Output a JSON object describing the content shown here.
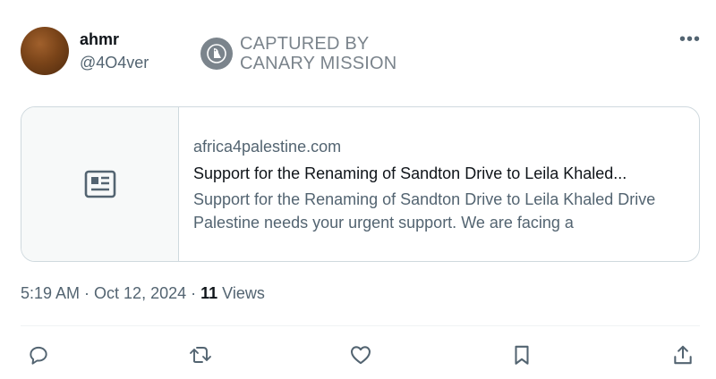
{
  "user": {
    "display_name": "ahmr",
    "handle": "@4O4ver"
  },
  "watermark": {
    "line1": "CAPTURED BY",
    "line2": "CANARY MISSION"
  },
  "more_label": "•••",
  "card": {
    "domain": "africa4palestine.com",
    "title": "Support for the Renaming of Sandton Drive to Leila Khaled...",
    "description": "Support for the Renaming of Sandton Drive to Leila Khaled Drive Palestine needs your urgent support. We are facing a"
  },
  "meta": {
    "time": "5:19 AM",
    "separator1": " · ",
    "date": "Oct 12, 2024",
    "separator2": " · ",
    "views_count": "11",
    "views_label": " Views"
  },
  "icons": {
    "reply": "reply-icon",
    "retweet": "retweet-icon",
    "like": "heart-icon",
    "bookmark": "bookmark-icon",
    "share": "share-icon",
    "article": "article-icon"
  },
  "colors": {
    "text": "#0f1419",
    "secondary": "#536471",
    "border": "#cfd9de",
    "watermark": "#7b848c"
  }
}
